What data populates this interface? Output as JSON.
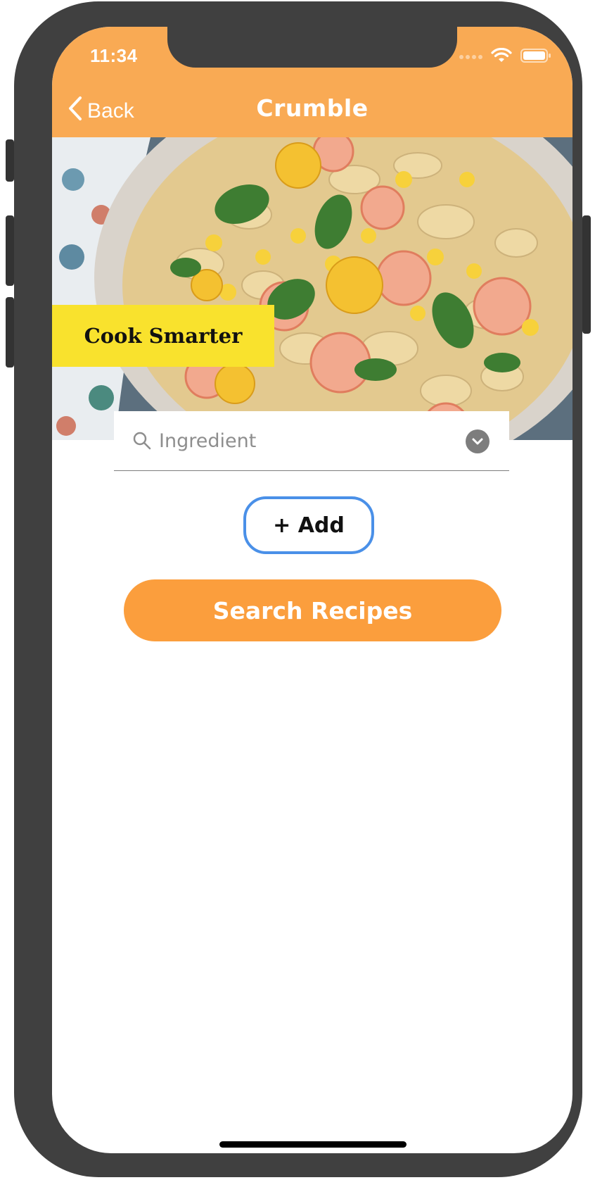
{
  "status_bar": {
    "time": "11:34",
    "icons": [
      "signal-dots-icon",
      "wifi-icon",
      "battery-icon"
    ]
  },
  "nav": {
    "back_label": "Back",
    "title": "Crumble"
  },
  "hero": {
    "banner_text": "Cook Smarter"
  },
  "search": {
    "placeholder": "Ingredient",
    "value": ""
  },
  "buttons": {
    "add_label": "+ Add",
    "search_recipes_label": "Search Recipes"
  },
  "colors": {
    "header": "#F9AA54",
    "banner": "#F9E22D",
    "add_border": "#4A90E8",
    "search_button": "#FB9E3D",
    "frame": "#404040"
  }
}
